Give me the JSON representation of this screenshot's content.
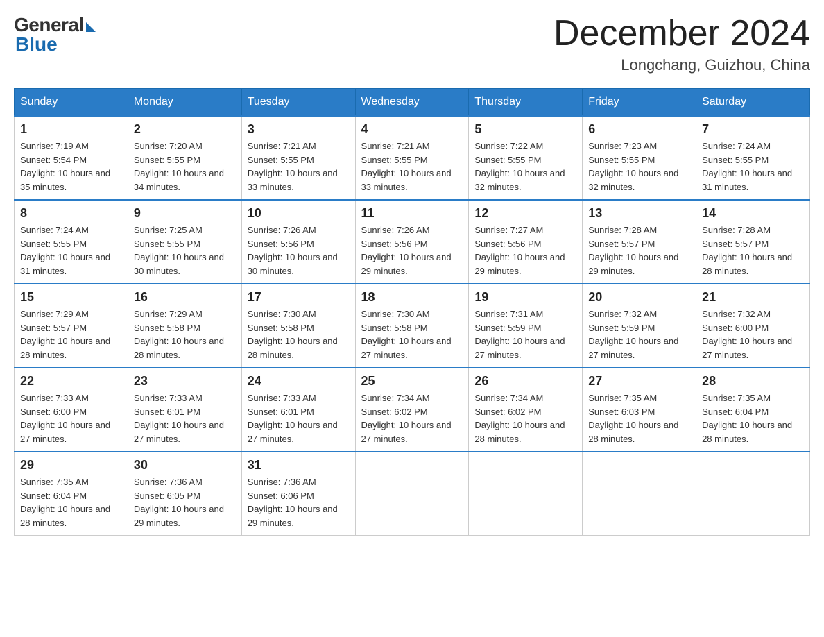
{
  "header": {
    "logo_general": "General",
    "logo_blue": "Blue",
    "title": "December 2024",
    "location": "Longchang, Guizhou, China"
  },
  "days_of_week": [
    "Sunday",
    "Monday",
    "Tuesday",
    "Wednesday",
    "Thursday",
    "Friday",
    "Saturday"
  ],
  "weeks": [
    [
      {
        "day": "1",
        "sunrise": "7:19 AM",
        "sunset": "5:54 PM",
        "daylight": "10 hours and 35 minutes."
      },
      {
        "day": "2",
        "sunrise": "7:20 AM",
        "sunset": "5:55 PM",
        "daylight": "10 hours and 34 minutes."
      },
      {
        "day": "3",
        "sunrise": "7:21 AM",
        "sunset": "5:55 PM",
        "daylight": "10 hours and 33 minutes."
      },
      {
        "day": "4",
        "sunrise": "7:21 AM",
        "sunset": "5:55 PM",
        "daylight": "10 hours and 33 minutes."
      },
      {
        "day": "5",
        "sunrise": "7:22 AM",
        "sunset": "5:55 PM",
        "daylight": "10 hours and 32 minutes."
      },
      {
        "day": "6",
        "sunrise": "7:23 AM",
        "sunset": "5:55 PM",
        "daylight": "10 hours and 32 minutes."
      },
      {
        "day": "7",
        "sunrise": "7:24 AM",
        "sunset": "5:55 PM",
        "daylight": "10 hours and 31 minutes."
      }
    ],
    [
      {
        "day": "8",
        "sunrise": "7:24 AM",
        "sunset": "5:55 PM",
        "daylight": "10 hours and 31 minutes."
      },
      {
        "day": "9",
        "sunrise": "7:25 AM",
        "sunset": "5:55 PM",
        "daylight": "10 hours and 30 minutes."
      },
      {
        "day": "10",
        "sunrise": "7:26 AM",
        "sunset": "5:56 PM",
        "daylight": "10 hours and 30 minutes."
      },
      {
        "day": "11",
        "sunrise": "7:26 AM",
        "sunset": "5:56 PM",
        "daylight": "10 hours and 29 minutes."
      },
      {
        "day": "12",
        "sunrise": "7:27 AM",
        "sunset": "5:56 PM",
        "daylight": "10 hours and 29 minutes."
      },
      {
        "day": "13",
        "sunrise": "7:28 AM",
        "sunset": "5:57 PM",
        "daylight": "10 hours and 29 minutes."
      },
      {
        "day": "14",
        "sunrise": "7:28 AM",
        "sunset": "5:57 PM",
        "daylight": "10 hours and 28 minutes."
      }
    ],
    [
      {
        "day": "15",
        "sunrise": "7:29 AM",
        "sunset": "5:57 PM",
        "daylight": "10 hours and 28 minutes."
      },
      {
        "day": "16",
        "sunrise": "7:29 AM",
        "sunset": "5:58 PM",
        "daylight": "10 hours and 28 minutes."
      },
      {
        "day": "17",
        "sunrise": "7:30 AM",
        "sunset": "5:58 PM",
        "daylight": "10 hours and 28 minutes."
      },
      {
        "day": "18",
        "sunrise": "7:30 AM",
        "sunset": "5:58 PM",
        "daylight": "10 hours and 27 minutes."
      },
      {
        "day": "19",
        "sunrise": "7:31 AM",
        "sunset": "5:59 PM",
        "daylight": "10 hours and 27 minutes."
      },
      {
        "day": "20",
        "sunrise": "7:32 AM",
        "sunset": "5:59 PM",
        "daylight": "10 hours and 27 minutes."
      },
      {
        "day": "21",
        "sunrise": "7:32 AM",
        "sunset": "6:00 PM",
        "daylight": "10 hours and 27 minutes."
      }
    ],
    [
      {
        "day": "22",
        "sunrise": "7:33 AM",
        "sunset": "6:00 PM",
        "daylight": "10 hours and 27 minutes."
      },
      {
        "day": "23",
        "sunrise": "7:33 AM",
        "sunset": "6:01 PM",
        "daylight": "10 hours and 27 minutes."
      },
      {
        "day": "24",
        "sunrise": "7:33 AM",
        "sunset": "6:01 PM",
        "daylight": "10 hours and 27 minutes."
      },
      {
        "day": "25",
        "sunrise": "7:34 AM",
        "sunset": "6:02 PM",
        "daylight": "10 hours and 27 minutes."
      },
      {
        "day": "26",
        "sunrise": "7:34 AM",
        "sunset": "6:02 PM",
        "daylight": "10 hours and 28 minutes."
      },
      {
        "day": "27",
        "sunrise": "7:35 AM",
        "sunset": "6:03 PM",
        "daylight": "10 hours and 28 minutes."
      },
      {
        "day": "28",
        "sunrise": "7:35 AM",
        "sunset": "6:04 PM",
        "daylight": "10 hours and 28 minutes."
      }
    ],
    [
      {
        "day": "29",
        "sunrise": "7:35 AM",
        "sunset": "6:04 PM",
        "daylight": "10 hours and 28 minutes."
      },
      {
        "day": "30",
        "sunrise": "7:36 AM",
        "sunset": "6:05 PM",
        "daylight": "10 hours and 29 minutes."
      },
      {
        "day": "31",
        "sunrise": "7:36 AM",
        "sunset": "6:06 PM",
        "daylight": "10 hours and 29 minutes."
      },
      null,
      null,
      null,
      null
    ]
  ]
}
